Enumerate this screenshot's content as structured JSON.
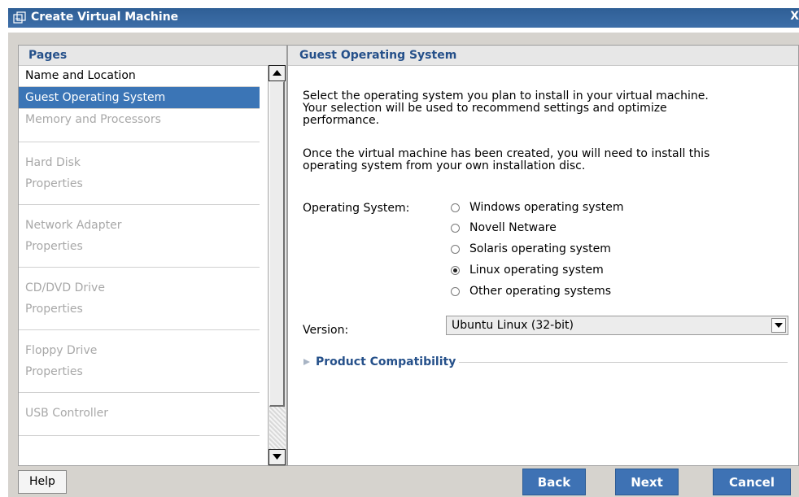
{
  "window": {
    "title": "Create Virtual Machine",
    "close_label": "X",
    "icon": "vm-window-icon"
  },
  "pages": {
    "header": "Pages",
    "items": [
      {
        "lines": [
          "Name and Location"
        ],
        "state": "done"
      },
      {
        "lines": [
          "Guest Operating System"
        ],
        "state": "active"
      },
      {
        "lines": [
          "Memory and Processors"
        ],
        "state": "disabled"
      },
      {
        "lines": [
          "Hard Disk",
          "Properties"
        ],
        "state": "disabled"
      },
      {
        "lines": [
          "Network Adapter",
          "Properties"
        ],
        "state": "disabled"
      },
      {
        "lines": [
          "CD/DVD Drive",
          "Properties"
        ],
        "state": "disabled"
      },
      {
        "lines": [
          "Floppy Drive",
          "Properties"
        ],
        "state": "disabled"
      },
      {
        "lines": [
          "USB Controller"
        ],
        "state": "disabled"
      }
    ]
  },
  "content": {
    "header": "Guest Operating System",
    "intro_lines": [
      "Select the operating system you plan to install in your virtual machine.",
      "Your selection will be used to recommend settings and optimize",
      "performance."
    ],
    "note_lines": [
      "Once the virtual machine has been created, you will need to install this",
      "operating system from your own installation disc."
    ],
    "os_label": "Operating System:",
    "os_options": [
      {
        "label": "Windows operating system",
        "selected": false
      },
      {
        "label": "Novell Netware",
        "selected": false
      },
      {
        "label": "Solaris operating system",
        "selected": false
      },
      {
        "label": "Linux operating system",
        "selected": true
      },
      {
        "label": "Other operating systems",
        "selected": false
      }
    ],
    "version_label": "Version:",
    "version_value": "Ubuntu Linux (32-bit)",
    "compat_label": "Product Compatibility"
  },
  "buttons": {
    "help": "Help",
    "back": "Back",
    "next": "Next",
    "cancel": "Cancel"
  },
  "colors": {
    "accent": "#3b75b6",
    "title_bar": "#3565a0",
    "header_text": "#25508a"
  }
}
